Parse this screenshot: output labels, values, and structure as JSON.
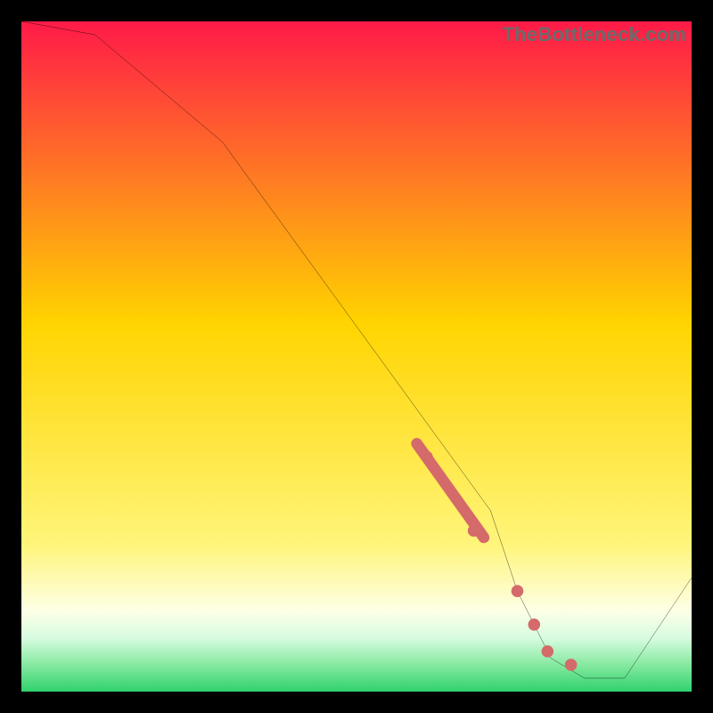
{
  "watermark": "TheBottleneck.com",
  "colors": {
    "black": "#000000",
    "grad_top": "#ff1a48",
    "grad_mid": "#ffd400",
    "grad_yellow_light": "#fff57a",
    "grad_cream": "#fdffe6",
    "grad_green1": "#d7fce0",
    "grad_green2": "#86e9a0",
    "grad_green3": "#2fd26d",
    "line": "#000000",
    "marker": "#d46a6a"
  },
  "chart_data": {
    "type": "line",
    "title": "",
    "xlabel": "",
    "ylabel": "",
    "xlim": [
      0,
      100
    ],
    "ylim": [
      0,
      100
    ],
    "grid": false,
    "legend": false,
    "series": [
      {
        "name": "bottleneck-curve",
        "x": [
          0,
          11,
          30,
          70,
          74,
          79,
          84,
          90,
          100
        ],
        "y": [
          100,
          98,
          82,
          27,
          15,
          5,
          2,
          2,
          17
        ]
      }
    ],
    "markers": [
      {
        "name": "cluster-segment-top",
        "x": 60.5,
        "y": 35
      },
      {
        "name": "cluster-segment-bottom",
        "x": 67.5,
        "y": 24
      },
      {
        "name": "point-a",
        "x": 74,
        "y": 15
      },
      {
        "name": "point-b",
        "x": 76.5,
        "y": 10
      },
      {
        "name": "point-c",
        "x": 78.5,
        "y": 6
      },
      {
        "name": "point-d",
        "x": 82,
        "y": 4
      }
    ],
    "marker_segment": {
      "x1": 59,
      "y1": 37,
      "x2": 69,
      "y2": 23,
      "width": 4.2
    }
  }
}
